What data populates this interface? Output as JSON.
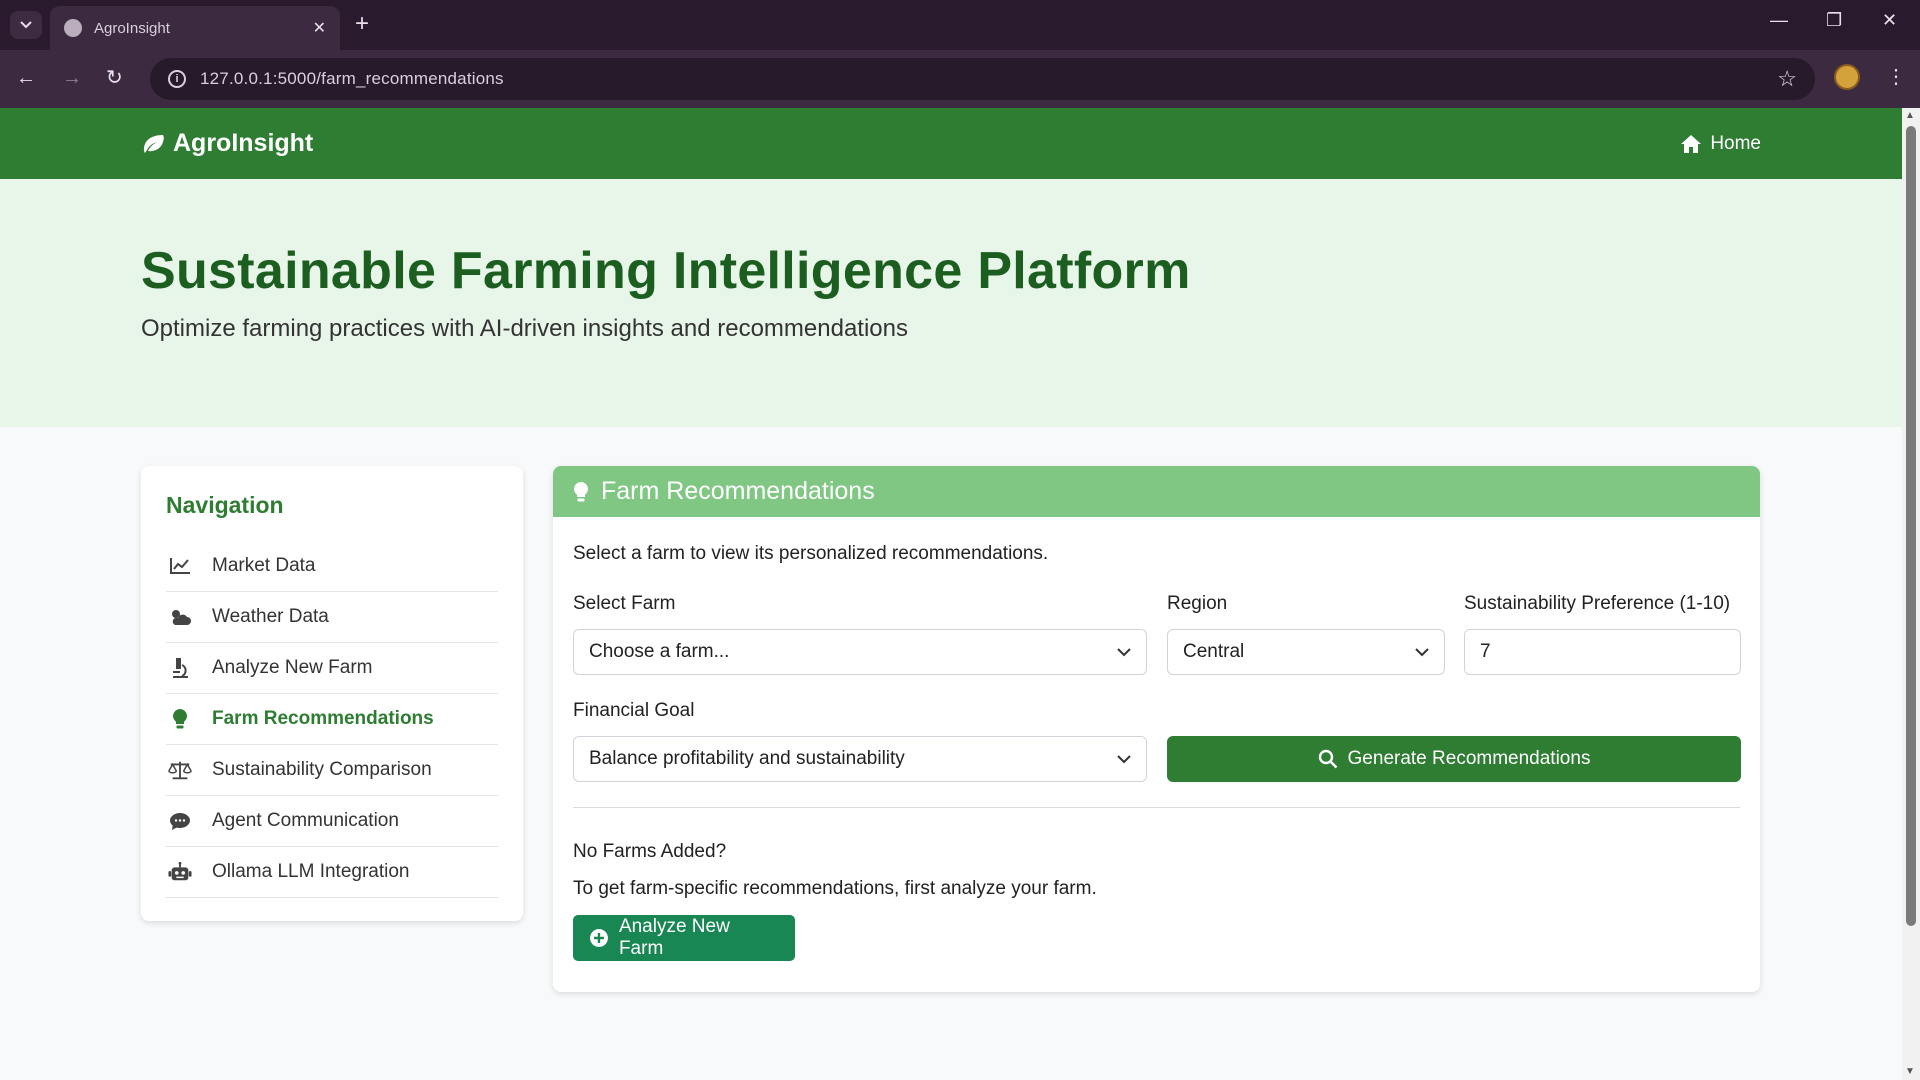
{
  "browser": {
    "tab_title": "AgroInsight",
    "url": "127.0.0.1:5000/farm_recommendations"
  },
  "nav": {
    "brand": "AgroInsight",
    "home_label": "Home"
  },
  "hero": {
    "title": "Sustainable Farming Intelligence Platform",
    "subtitle": "Optimize farming practices with AI-driven insights and recommendations"
  },
  "sidebar": {
    "heading": "Navigation",
    "items": [
      {
        "label": "Market Data",
        "icon": "chart-line-icon"
      },
      {
        "label": "Weather Data",
        "icon": "cloud-sun-icon"
      },
      {
        "label": "Analyze New Farm",
        "icon": "microscope-icon"
      },
      {
        "label": "Farm Recommendations",
        "icon": "lightbulb-icon",
        "active": true
      },
      {
        "label": "Sustainability Comparison",
        "icon": "balance-scale-icon"
      },
      {
        "label": "Agent Communication",
        "icon": "comment-icon"
      },
      {
        "label": "Ollama LLM Integration",
        "icon": "robot-icon"
      }
    ]
  },
  "card": {
    "title": "Farm Recommendations",
    "intro": "Select a farm to view its personalized recommendations.",
    "select_farm_label": "Select Farm",
    "select_farm_value": "Choose a farm...",
    "region_label": "Region",
    "region_value": "Central",
    "sustainability_label": "Sustainability Preference (1-10)",
    "sustainability_value": "7",
    "financial_goal_label": "Financial Goal",
    "financial_goal_value": "Balance profitability and sustainability",
    "generate_label": "Generate Recommendations",
    "no_farms_heading": "No Farms Added?",
    "no_farms_text": "To get farm-specific recommendations, first analyze your farm.",
    "analyze_button": "Analyze New Farm"
  },
  "colors": {
    "primary": "#2e7d32",
    "header_light": "#81c784",
    "hero_bg": "#e8f5e9",
    "success": "#198754"
  }
}
